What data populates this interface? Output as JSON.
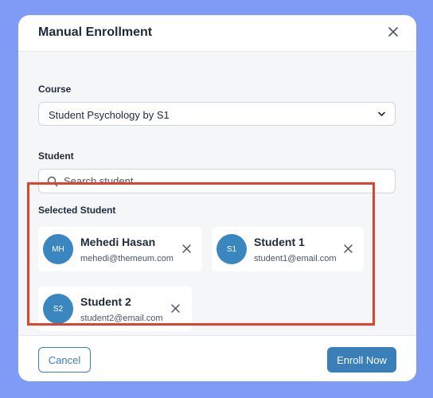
{
  "dialog": {
    "title": "Manual Enrollment",
    "close_icon": "close-icon"
  },
  "course": {
    "label": "Course",
    "selected": "Student Psychology by S1",
    "icon": "chevron-down-icon"
  },
  "student": {
    "label": "Student",
    "search_placeholder": "Search student..",
    "search_value": "",
    "icon": "search-icon"
  },
  "selected_students": {
    "label": "Selected Student",
    "items": [
      {
        "initials": "MH",
        "name": "Mehedi Hasan",
        "email": "mehedi@themeum.com"
      },
      {
        "initials": "S1",
        "name": "Student 1",
        "email": "student1@email.com"
      },
      {
        "initials": "S2",
        "name": "Student 2",
        "email": "student2@email.com"
      }
    ]
  },
  "footer": {
    "cancel_label": "Cancel",
    "enroll_label": "Enroll Now"
  },
  "colors": {
    "backdrop": "#7f9bf6",
    "primary": "#3a7fb8",
    "avatar": "#3a86bf",
    "highlight": "#e0432d"
  }
}
